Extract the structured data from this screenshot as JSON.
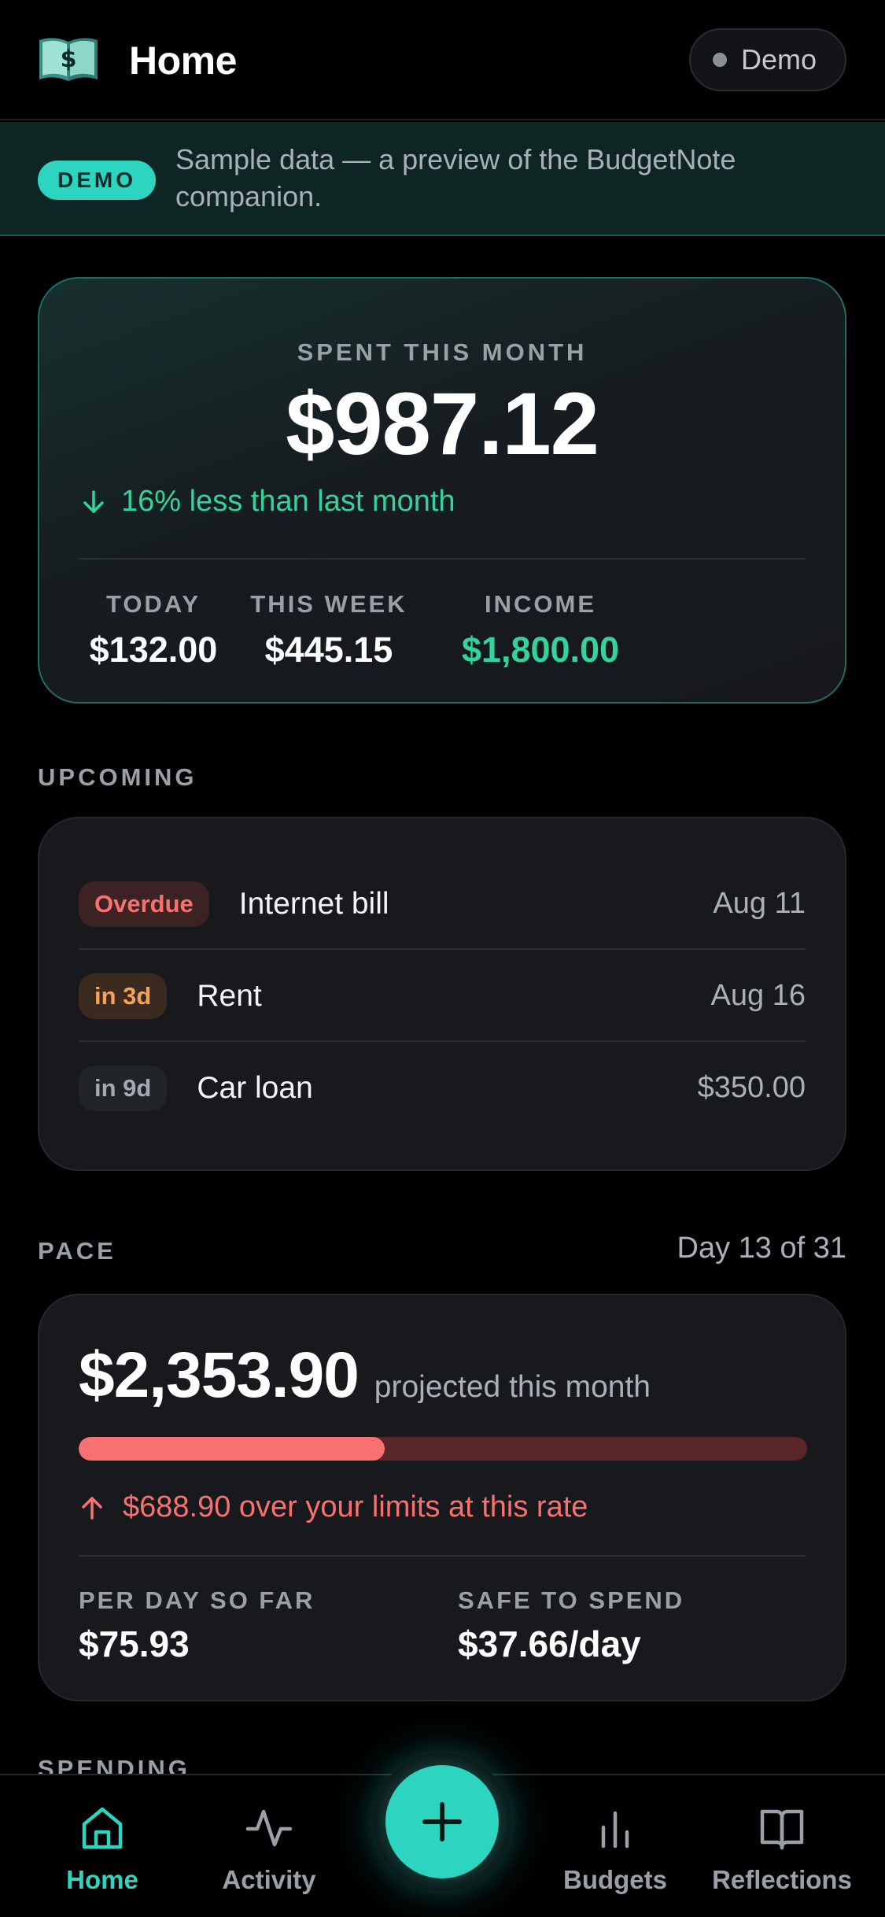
{
  "header": {
    "title": "Home",
    "demo_label": "Demo"
  },
  "banner": {
    "badge": "DEMO",
    "text": "Sample data — a preview of the BudgetNote companion."
  },
  "spent": {
    "label": "SPENT THIS MONTH",
    "amount": "$987.12",
    "delta": "16% less than last month",
    "stats": [
      {
        "label": "TODAY",
        "value": "$132.00"
      },
      {
        "label": "THIS WEEK",
        "value": "$445.15"
      },
      {
        "label": "INCOME",
        "value": "$1,800.00"
      }
    ]
  },
  "upcoming": {
    "label": "UPCOMING",
    "items": [
      {
        "tag": "Overdue",
        "name": "Internet bill",
        "right": "Aug 11"
      },
      {
        "tag": "in 3d",
        "name": "Rent",
        "right": "Aug 16"
      },
      {
        "tag": "in 9d",
        "name": "Car loan",
        "right": "$350.00"
      }
    ]
  },
  "pace": {
    "label": "PACE",
    "day": "Day 13 of 31",
    "projected": "$2,353.90",
    "projected_sub": "projected this month",
    "progress_fraction": 0.42,
    "warning": "$688.90 over your limits at this rate",
    "per_day_label": "PER DAY SO FAR",
    "per_day_value": "$75.93",
    "safe_label": "SAFE TO SPEND",
    "safe_value": "$37.66/day"
  },
  "spending": {
    "label": "SPENDING"
  },
  "tabs": [
    {
      "label": "Home",
      "icon": "home-icon",
      "active": true
    },
    {
      "label": "Activity",
      "icon": "activity-icon",
      "active": false
    },
    {
      "label": "Budgets",
      "icon": "bar-chart-icon",
      "active": false
    },
    {
      "label": "Reflections",
      "icon": "book-open-icon",
      "active": false
    }
  ],
  "colors": {
    "accent": "#2dd4bf",
    "positive": "#34d399",
    "danger": "#f87171",
    "warning": "#f5a25d",
    "background": "#000000",
    "card": "#17191d"
  }
}
